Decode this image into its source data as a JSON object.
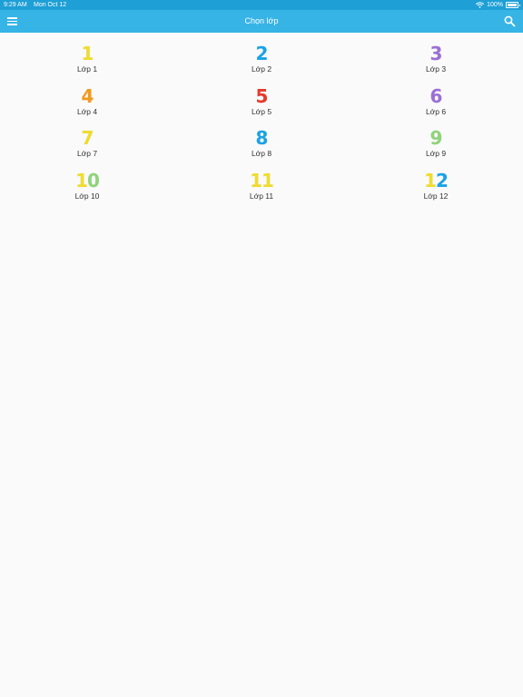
{
  "status_bar": {
    "time": "9:29 AM",
    "date": "Mon Oct 12",
    "battery": "100%"
  },
  "app_bar": {
    "title": "Chọn lớp",
    "menu_icon": "hamburger-icon",
    "search_icon": "search-icon"
  },
  "colors": {
    "status_bar_bg": "#1e9fd6",
    "app_bar_bg": "#37b4e6",
    "background": "#fafafa"
  },
  "grades": [
    {
      "number": "1",
      "label": "Lớp 1",
      "color": "#f0dc2c"
    },
    {
      "number": "2",
      "label": "Lớp 2",
      "color": "#1aa3e8"
    },
    {
      "number": "3",
      "label": "Lớp 3",
      "color": "#9b6fd6"
    },
    {
      "number": "4",
      "label": "Lớp 4",
      "color": "#f39a1c"
    },
    {
      "number": "5",
      "label": "Lớp 5",
      "color": "#e63a2a"
    },
    {
      "number": "6",
      "label": "Lớp 6",
      "color": "#9b6fd6"
    },
    {
      "number": "7",
      "label": "Lớp 7",
      "color": "#f0dc2c"
    },
    {
      "number": "8",
      "label": "Lớp 8",
      "color": "#1aa3e8"
    },
    {
      "number": "9",
      "label": "Lớp 9",
      "color": "#8fd47a"
    },
    {
      "number": "10",
      "label": "Lớp 10",
      "color": "#f0dc2c",
      "color2": "#8fd47a"
    },
    {
      "number": "11",
      "label": "Lớp 11",
      "color": "#f0dc2c",
      "color2": "#f0dc2c"
    },
    {
      "number": "12",
      "label": "Lớp 12",
      "color": "#f0dc2c",
      "color2": "#1aa3e8"
    }
  ]
}
